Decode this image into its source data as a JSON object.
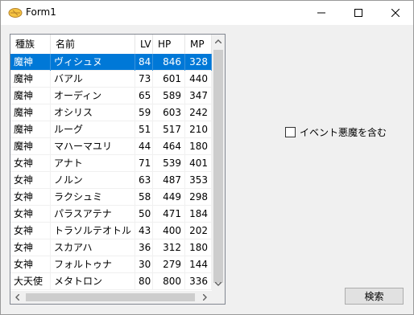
{
  "window": {
    "title": "Form1"
  },
  "columns": [
    "種族",
    "名前",
    "LV",
    "HP",
    "MP"
  ],
  "rows": [
    [
      "魔神",
      "ヴィシュヌ",
      "84",
      "846",
      "328"
    ],
    [
      "魔神",
      "バアル",
      "73",
      "601",
      "440"
    ],
    [
      "魔神",
      "オーディン",
      "65",
      "589",
      "347"
    ],
    [
      "魔神",
      "オシリス",
      "59",
      "603",
      "242"
    ],
    [
      "魔神",
      "ルーグ",
      "51",
      "517",
      "210"
    ],
    [
      "魔神",
      "マハーマユリ",
      "44",
      "464",
      "180"
    ],
    [
      "女神",
      "アナト",
      "71",
      "539",
      "401"
    ],
    [
      "女神",
      "ノルン",
      "63",
      "487",
      "353"
    ],
    [
      "女神",
      "ラクシュミ",
      "58",
      "449",
      "298"
    ],
    [
      "女神",
      "パラスアテナ",
      "50",
      "471",
      "184"
    ],
    [
      "女神",
      "トラソルテオトル",
      "43",
      "400",
      "202"
    ],
    [
      "女神",
      "スカアハ",
      "36",
      "312",
      "180"
    ],
    [
      "女神",
      "フォルトゥナ",
      "30",
      "279",
      "144"
    ],
    [
      "大天使",
      "メタトロン",
      "80",
      "800",
      "336"
    ]
  ],
  "selected_row": 0,
  "checkbox": {
    "label": "イベント悪魔を含む",
    "checked": false
  },
  "search_button": "検索",
  "colors": {
    "selection": "#0078d7",
    "background": "#f0f0f0"
  }
}
